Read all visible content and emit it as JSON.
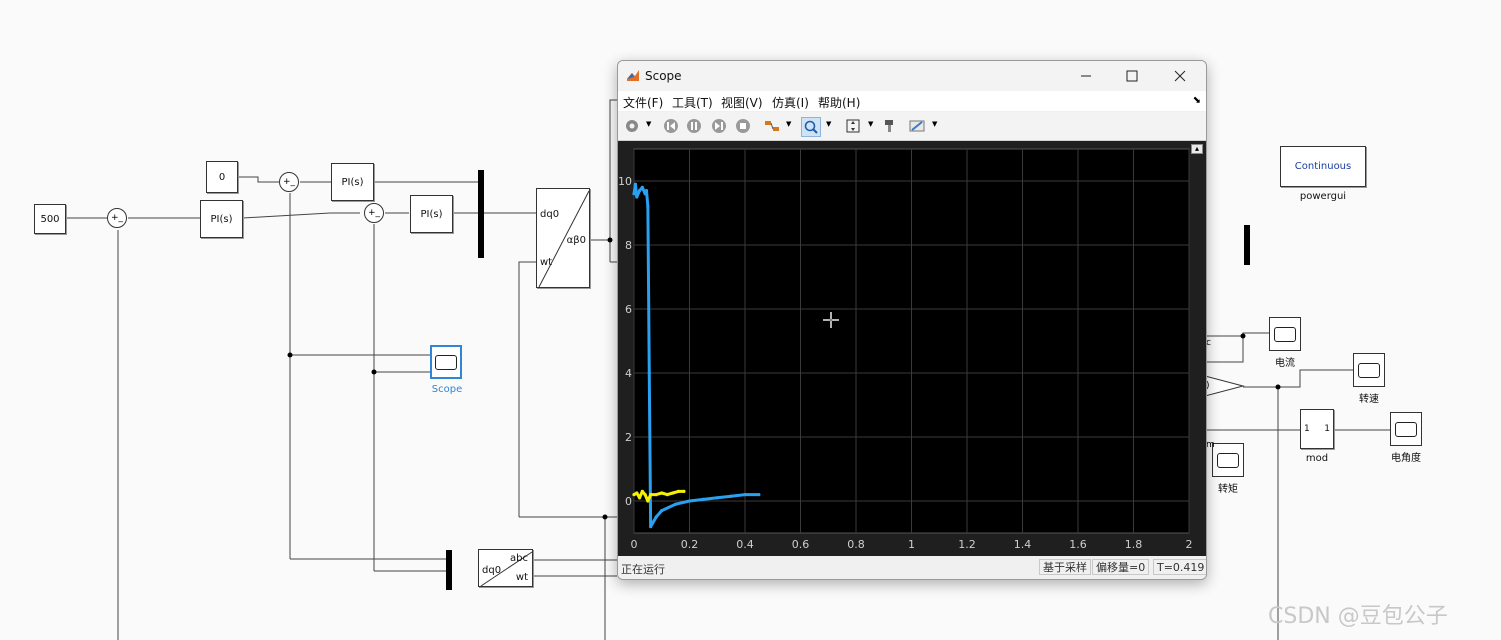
{
  "diagram": {
    "const_500": "500",
    "const_0": "0",
    "pi_label": "PI(s)",
    "sum_signs": "+_",
    "transform_dq0": "dq0",
    "transform_ab0": "αβ0",
    "transform_wt": "wt",
    "inv_abc": "abc",
    "inv_dq0": "dq0",
    "inv_wt": "wt",
    "scope_label": "Scope",
    "powergui_block": "Continuous",
    "powergui_label": "powergui",
    "current_label": "电流",
    "speed_label": "转速",
    "angle_label": "电角度",
    "torque_label": "转矩",
    "mod_label": "mod",
    "mod_in": "1",
    "mod_out": "1",
    "partial_c": "c",
    "partial_paren": ")",
    "partial_m": "m"
  },
  "scope_window": {
    "title": "Scope",
    "menu": [
      "文件(F)",
      "工具(T)",
      "视图(V)",
      "仿真(I)",
      "帮助(H)"
    ],
    "toolbar_icons": [
      "gear-icon",
      "step-back-icon",
      "pause-icon",
      "step-forward-icon",
      "stop-icon",
      "highlight-icon",
      "zoom-icon",
      "fit-icon",
      "style-icon",
      "measure-icon"
    ],
    "status": {
      "state": "正在运行",
      "sample": "基于采样",
      "offset": "偏移量=0",
      "time": "T=0.419"
    }
  },
  "chart_data": {
    "type": "line",
    "xlim": [
      0,
      2
    ],
    "ylim": [
      -1,
      11
    ],
    "xticks": [
      "0",
      "0.2",
      "0.4",
      "0.6",
      "0.8",
      "1",
      "1.2",
      "1.4",
      "1.6",
      "1.8",
      "2"
    ],
    "yticks": [
      "0",
      "2",
      "4",
      "6",
      "8",
      "10"
    ],
    "grid": true,
    "background": "#000000",
    "series": [
      {
        "color": "#2aa0f0",
        "x": [
          0,
          0.005,
          0.01,
          0.02,
          0.03,
          0.04,
          0.045,
          0.05,
          0.055,
          0.06,
          0.08,
          0.1,
          0.15,
          0.2,
          0.25,
          0.3,
          0.35,
          0.4,
          0.45
        ],
        "y": [
          9.6,
          9.9,
          9.5,
          9.7,
          9.8,
          9.6,
          9.7,
          9.2,
          4.0,
          -0.8,
          -0.5,
          -0.3,
          -0.1,
          0.0,
          0.05,
          0.1,
          0.15,
          0.2,
          0.2
        ]
      },
      {
        "color": "#f5f000",
        "x": [
          0,
          0.01,
          0.02,
          0.03,
          0.04,
          0.05,
          0.06,
          0.08,
          0.1,
          0.12,
          0.14,
          0.16,
          0.18
        ],
        "y": [
          0.2,
          0.25,
          0.1,
          0.3,
          0.2,
          0.0,
          0.2,
          0.2,
          0.25,
          0.2,
          0.25,
          0.3,
          0.3
        ]
      }
    ]
  },
  "watermark": "CSDN @豆包公子"
}
